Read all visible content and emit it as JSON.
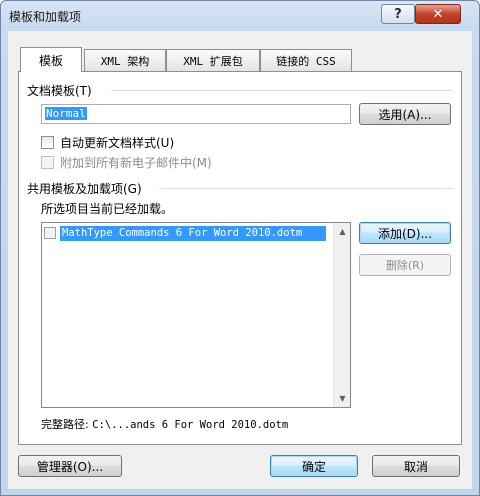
{
  "window": {
    "title": "模板和加载项",
    "help_label": "?",
    "close_label": "✕"
  },
  "tabs": [
    {
      "label": "模板"
    },
    {
      "label": "XML 架构"
    },
    {
      "label": "XML 扩展包"
    },
    {
      "label": "链接的 CSS"
    }
  ],
  "template_section": {
    "label": "文档模板(T)",
    "template_value": "Normal",
    "select_button": "选用(A)...",
    "auto_update_label": "自动更新文档样式(U)",
    "attach_email_label": "附加到所有新电子邮件中(M)"
  },
  "global_section": {
    "label": "共用模板及加载项(G)",
    "sub_label": "所选项目当前已经加载。",
    "items": [
      {
        "label": "MathType Commands 6 For Word 2010.dotm",
        "checked": false
      }
    ],
    "add_button": "添加(D)...",
    "remove_button": "删除(R)",
    "path_label": "完整路径:",
    "path_value": "C:\\...ands 6 For Word 2010.dotm"
  },
  "footer": {
    "organizer_button": "管理器(O)...",
    "ok_button": "确定",
    "cancel_button": "取消"
  }
}
